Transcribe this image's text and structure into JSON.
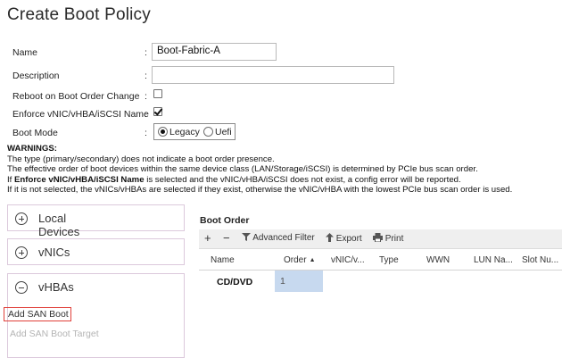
{
  "page": {
    "title": "Create Boot Policy"
  },
  "form": {
    "name_label": "Name",
    "name_value": "Boot-Fabric-A",
    "description_label": "Description",
    "description_value": "",
    "reboot_label": "Reboot on Boot Order Change",
    "reboot_checked": false,
    "enforce_label": "Enforce vNIC/vHBA/iSCSI Name",
    "enforce_checked": true,
    "boot_mode_label": "Boot Mode",
    "boot_mode_options": [
      "Legacy",
      "Uefi"
    ],
    "boot_mode_selected": "Legacy"
  },
  "warnings": {
    "heading": "WARNINGS:",
    "line1": "The type (primary/secondary) does not indicate a boot order presence.",
    "line2": "The effective order of boot devices within the same device class (LAN/Storage/iSCSI) is determined by PCIe bus scan order.",
    "line3_prefix": "If ",
    "line3_bold": "Enforce vNIC/vHBA/iSCSI Name",
    "line3_suffix": " is selected and the vNIC/vHBA/iSCSI does not exist, a config error will be reported.",
    "line4": "If it is not selected, the vNICs/vHBAs are selected if they exist, otherwise the vNIC/vHBA with the lowest PCIe bus scan order is used."
  },
  "left_panels": {
    "local_devices": "Local Devices",
    "vnics": "vNICs",
    "vhbas": "vHBAs",
    "add_san_boot": "Add SAN Boot",
    "add_san_boot_target": "Add SAN Boot Target"
  },
  "boot_order": {
    "title": "Boot Order",
    "toolbar": {
      "add": "+",
      "remove": "−",
      "advanced_filter": "Advanced Filter",
      "export": "Export",
      "print": "Print"
    },
    "columns": [
      "Name",
      "Order",
      "vNIC/v...",
      "Type",
      "WWN",
      "LUN Na...",
      "Slot Nu..."
    ],
    "sort_column": "Order",
    "rows": [
      {
        "name": "CD/DVD",
        "order": "1"
      }
    ]
  }
}
